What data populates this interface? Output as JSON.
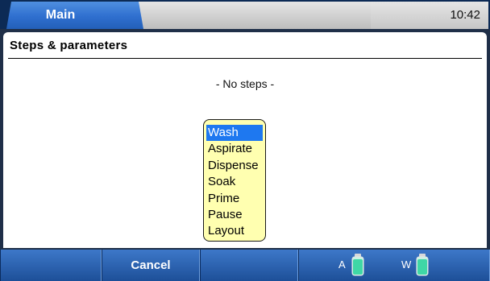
{
  "tabs": {
    "main_label": "Main"
  },
  "clock": "10:42",
  "section": {
    "title": "Steps & parameters",
    "empty_text": "- No steps -"
  },
  "menu": {
    "items": [
      "Wash",
      "Aspirate",
      "Dispense",
      "Soak",
      "Prime",
      "Pause",
      "Layout"
    ],
    "selected": "Wash"
  },
  "bottom": {
    "cancel_label": "Cancel",
    "reservoir_a_label": "A",
    "reservoir_w_label": "W"
  },
  "colors": {
    "accent": "#2f6fcf",
    "selection": "#1e78f0",
    "menu_bg": "#ffffb0",
    "bottle": "#3fd7a6"
  }
}
